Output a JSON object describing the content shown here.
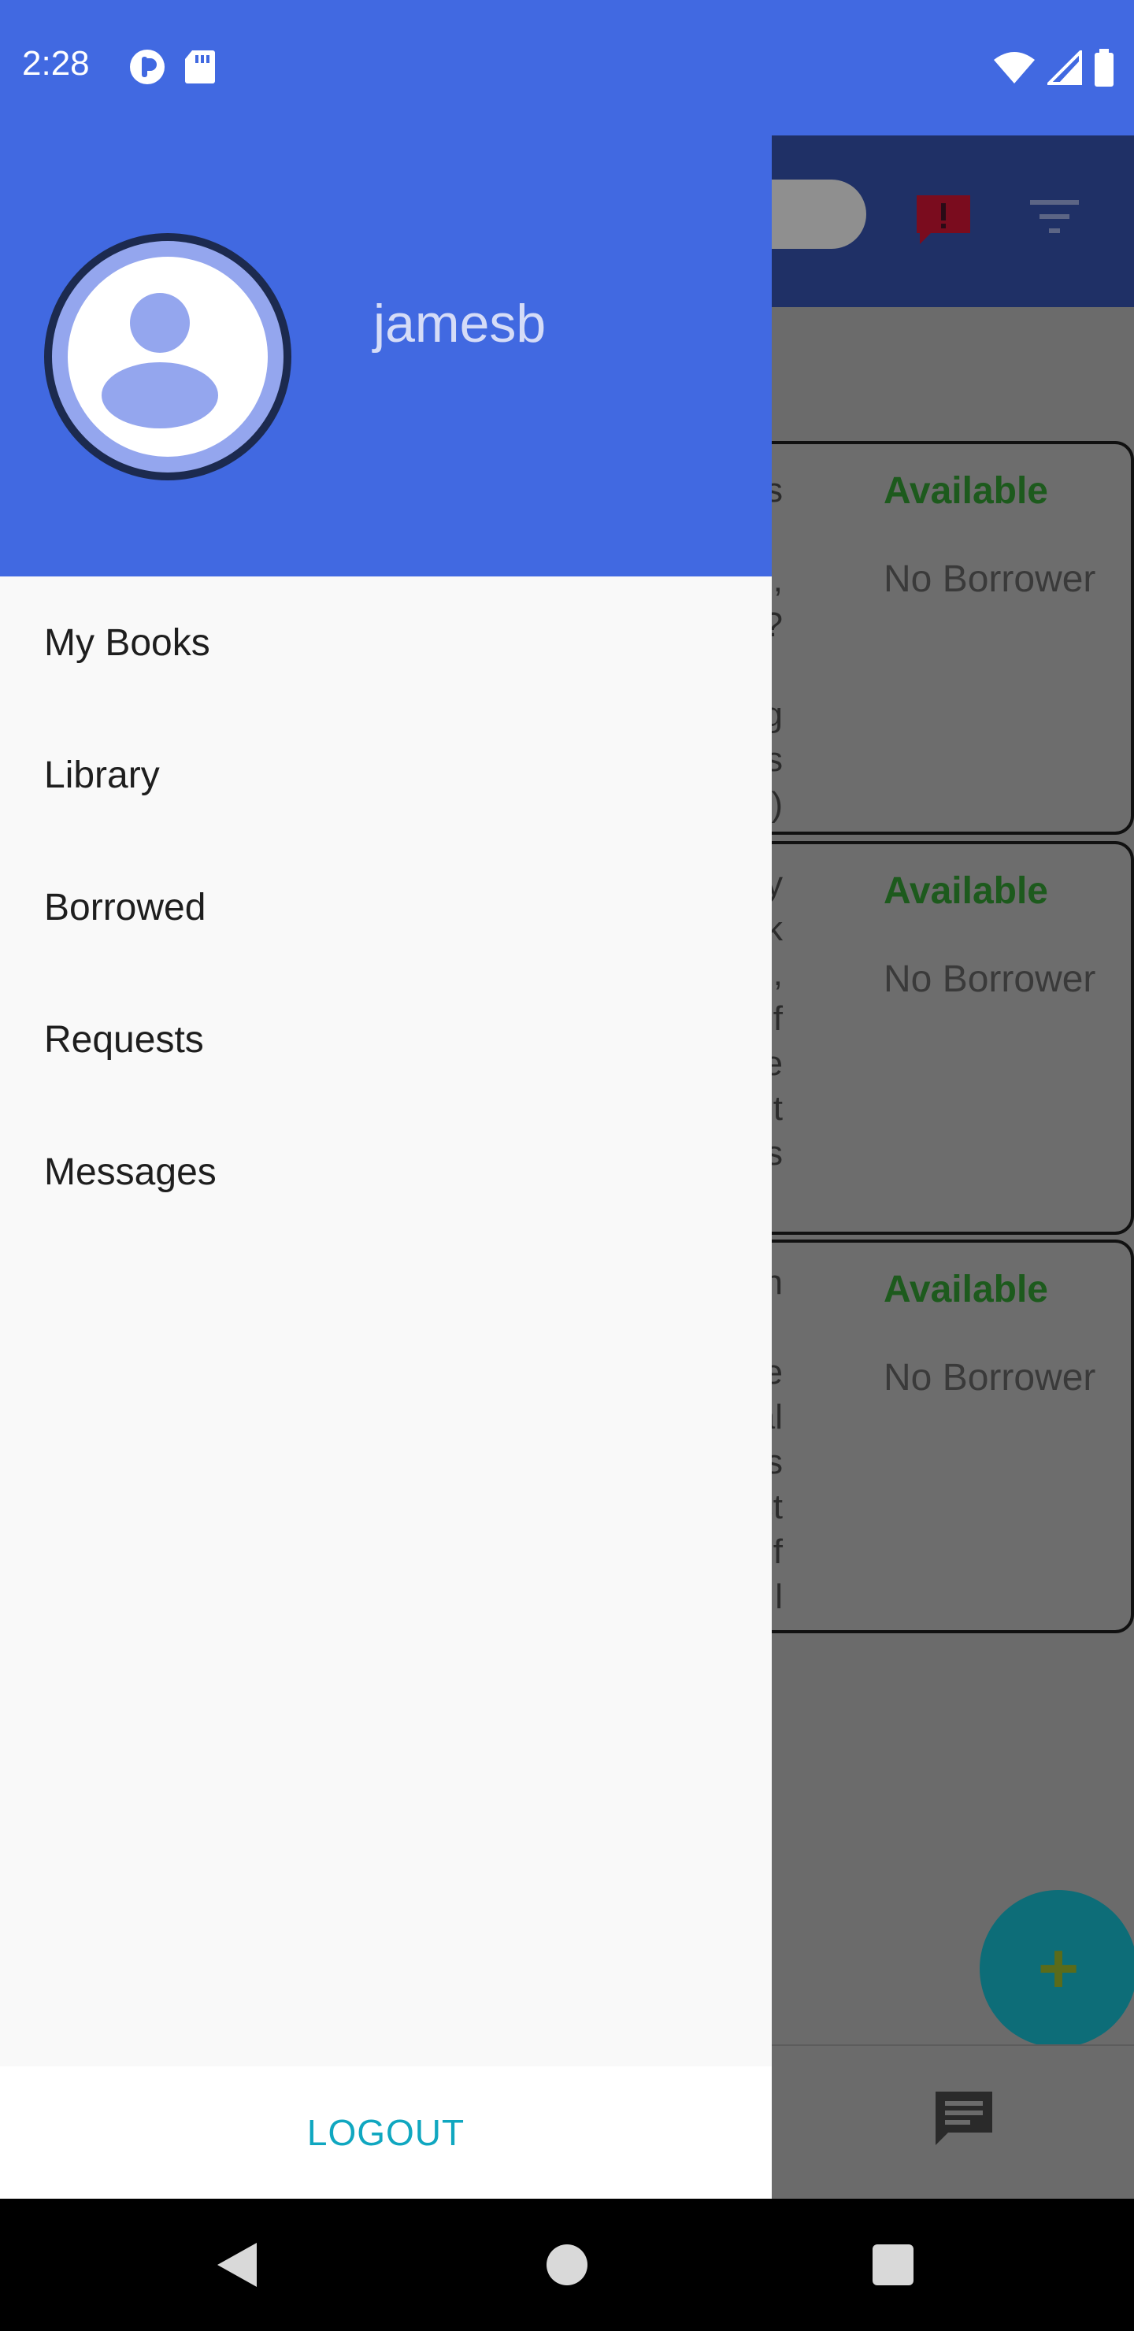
{
  "status_bar": {
    "time": "2:28",
    "left_icons": [
      "tumblr-app-icon",
      "sd-card-icon"
    ],
    "right_icons": [
      "wifi-icon",
      "signal-icon",
      "battery-icon"
    ]
  },
  "drawer": {
    "username": "jamesb",
    "menu_items": [
      {
        "label": "My Books"
      },
      {
        "label": "Library"
      },
      {
        "label": "Borrowed"
      },
      {
        "label": "Requests"
      },
      {
        "label": "Messages"
      }
    ],
    "logout_label": "LOGOUT"
  },
  "background_list": {
    "cards": [
      {
        "snippet": "y\"s\n\nure,\ns?\n\ng\ndy\"s\nfter)",
        "status": "Available",
        "borrower": "No Borrower"
      },
      {
        "snippet": "fty\nrk\no,\ns of\nne\nout\njoys",
        "status": "Available",
        "borrower": "No Borrower"
      },
      {
        "snippet": "gh\n\n the\nal\ns\nst\nelf\nl",
        "status": "Available",
        "borrower": "No Borrower"
      }
    ],
    "fab_label": "+"
  },
  "colors": {
    "primary": "#4169e1",
    "available": "#1d5a1d",
    "accent": "#10a7c0"
  }
}
